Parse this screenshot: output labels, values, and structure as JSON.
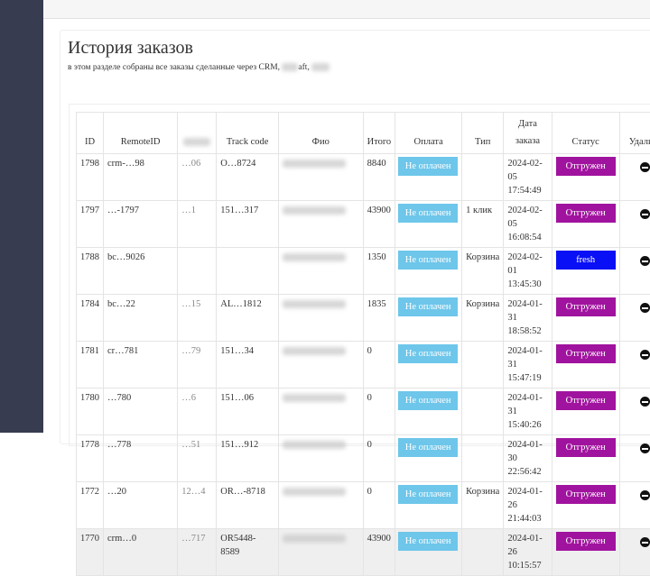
{
  "title": "История заказов",
  "subtitle_pre": "в этом разделе собраны все заказы сделанные через CRM,",
  "subtitle_mid": "aft,",
  "headers": [
    "ID",
    "RemoteID",
    "",
    "Track code",
    "Фио",
    "Итого",
    "Оплата",
    "Тип",
    "Дата заказа",
    "Статус",
    "Удалить"
  ],
  "colors": {
    "paid_btn": "#6ec6ea",
    "shipped": "#a0139e",
    "fresh": "#0a10f5",
    "sidebar": "#373c50"
  },
  "rows": [
    {
      "id": "1798",
      "remote": "crm-…98",
      "ext": "…06",
      "track": "O…8724",
      "fio": "",
      "total": "8840",
      "pay": "Не оплачен",
      "type": "",
      "date": "2024-02-05",
      "time": "17:54:49",
      "status": "Отгружен",
      "sc": "shipped"
    },
    {
      "id": "1797",
      "remote": "…-1797",
      "ext": "…1",
      "track": "151…317",
      "fio": "",
      "total": "43900",
      "pay": "Не оплачен",
      "type": "1 клик",
      "date": "2024-02-05",
      "time": "16:08:54",
      "status": "Отгружен",
      "sc": "shipped"
    },
    {
      "id": "1788",
      "remote": "bc…9026",
      "ext": "",
      "track": "",
      "fio": "",
      "total": "1350",
      "pay": "Не оплачен",
      "type": "Корзина",
      "date": "2024-02-01",
      "time": "13:45:30",
      "status": "fresh",
      "sc": "fresh"
    },
    {
      "id": "1784",
      "remote": "bc…22",
      "ext": "…15",
      "track": "AL…1812",
      "fio": "",
      "total": "1835",
      "pay": "Не оплачен",
      "type": "Корзина",
      "date": "2024-01-31",
      "time": "18:58:52",
      "status": "Отгружен",
      "sc": "shipped"
    },
    {
      "id": "1781",
      "remote": "cr…781",
      "ext": "…79",
      "track": "151…34",
      "fio": "",
      "total": "0",
      "pay": "Не оплачен",
      "type": "",
      "date": "2024-01-31",
      "time": "15:47:19",
      "status": "Отгружен",
      "sc": "shipped"
    },
    {
      "id": "1780",
      "remote": "…780",
      "ext": "…6",
      "track": "151…06",
      "fio": "",
      "total": "0",
      "pay": "Не оплачен",
      "type": "",
      "date": "2024-01-31",
      "time": "15:40:26",
      "status": "Отгружен",
      "sc": "shipped"
    },
    {
      "id": "1778",
      "remote": "…778",
      "ext": "…51",
      "track": "151…912",
      "fio": "",
      "total": "0",
      "pay": "Не оплачен",
      "type": "",
      "date": "2024-01-30",
      "time": "22:56:42",
      "status": "Отгружен",
      "sc": "shipped"
    },
    {
      "id": "1772",
      "remote": "…20",
      "ext": "12…4",
      "track": "OR…-8718",
      "fio": "",
      "total": "0",
      "pay": "Не оплачен",
      "type": "Корзина",
      "date": "2024-01-26",
      "time": "21:44:03",
      "status": "Отгружен",
      "sc": "shipped"
    },
    {
      "id": "1770",
      "remote": "crm…0",
      "ext": "…717",
      "track": "OR5448-8589",
      "fio": "",
      "total": "43900",
      "pay": "Не оплачен",
      "type": "",
      "date": "2024-01-26",
      "time": "10:15:57",
      "status": "Отгружен",
      "sc": "shipped"
    }
  ]
}
